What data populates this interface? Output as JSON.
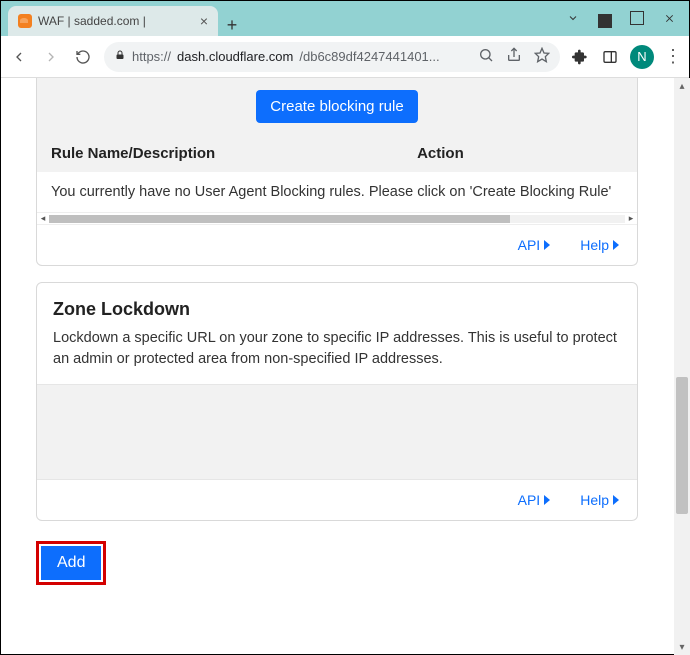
{
  "window": {
    "tab_title": "WAF | sadded.com |",
    "avatar_letter": "N"
  },
  "address": {
    "scheme": "https://",
    "host": "dash.cloudflare.com",
    "path": "/db6c89df4247441401..."
  },
  "user_agent_blocking": {
    "create_button": "Create blocking rule",
    "col_name": "Rule Name/Description",
    "col_action": "Action",
    "empty_message": "You currently have no User Agent Blocking rules. Please click on 'Create Blocking Rule'",
    "api_label": "API",
    "help_label": "Help"
  },
  "zone_lockdown": {
    "title": "Zone Lockdown",
    "description": "Lockdown a specific URL on your zone to specific IP addresses. This is useful to protect an admin or protected area from non-specified IP addresses.",
    "api_label": "API",
    "help_label": "Help"
  },
  "add_button": "Add"
}
